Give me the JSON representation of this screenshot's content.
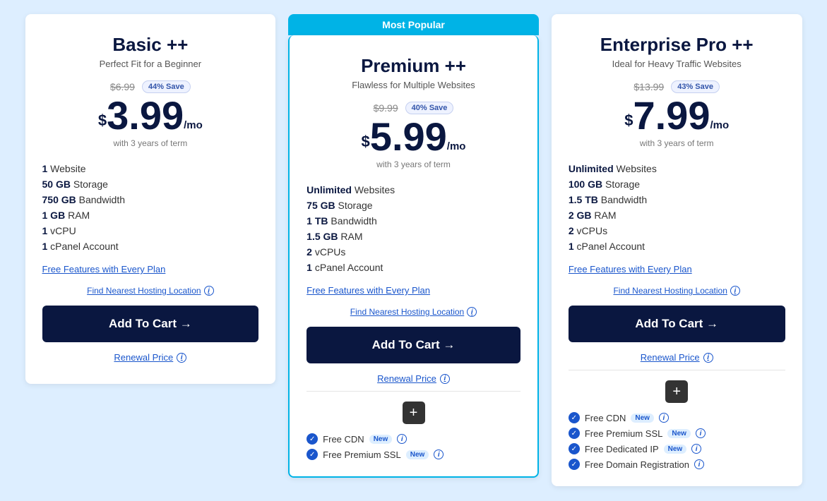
{
  "plans": [
    {
      "id": "basic",
      "title": "Basic ++",
      "subtitle": "Perfect Fit for a Beginner",
      "originalPrice": "$6.99",
      "saveBadge": "44% Save",
      "dollarSign": "$",
      "priceNumber": "3.99",
      "perMo": "/mo",
      "priceNote": "with 3 years of term",
      "features": [
        {
          "bold": "1",
          "text": " Website"
        },
        {
          "bold": "50 GB",
          "text": " Storage"
        },
        {
          "bold": "750 GB",
          "text": " Bandwidth"
        },
        {
          "bold": "1 GB",
          "text": " RAM"
        },
        {
          "bold": "1",
          "text": " vCPU"
        },
        {
          "bold": "1",
          "text": " cPanel Account"
        }
      ],
      "freeFeaturesLabel": "Free Features with Every Plan",
      "hostingLocationLabel": "Find Nearest Hosting Location",
      "addToCartLabel": "Add To Cart →",
      "renewalPriceLabel": "Renewal Price",
      "featured": false,
      "bonusFeatures": []
    },
    {
      "id": "premium",
      "title": "Premium ++",
      "subtitle": "Flawless for Multiple Websites",
      "originalPrice": "$9.99",
      "saveBadge": "40% Save",
      "dollarSign": "$",
      "priceNumber": "5.99",
      "perMo": "/mo",
      "priceNote": "with 3 years of term",
      "features": [
        {
          "bold": "Unlimited",
          "text": " Websites"
        },
        {
          "bold": "75 GB",
          "text": " Storage"
        },
        {
          "bold": "1 TB",
          "text": " Bandwidth"
        },
        {
          "bold": "1.5 GB",
          "text": " RAM"
        },
        {
          "bold": "2",
          "text": " vCPUs"
        },
        {
          "bold": "1",
          "text": " cPanel Account"
        }
      ],
      "freeFeaturesLabel": "Free Features with Every Plan",
      "hostingLocationLabel": "Find Nearest Hosting Location",
      "addToCartLabel": "Add To Cart →",
      "renewalPriceLabel": "Renewal Price",
      "featured": true,
      "mostPopularLabel": "Most Popular",
      "bonusFeatures": [
        {
          "text": "Free CDN",
          "badge": "New"
        },
        {
          "text": "Free Premium SSL",
          "badge": "New"
        }
      ]
    },
    {
      "id": "enterprise",
      "title": "Enterprise Pro ++",
      "subtitle": "Ideal for Heavy Traffic Websites",
      "originalPrice": "$13.99",
      "saveBadge": "43% Save",
      "dollarSign": "$",
      "priceNumber": "7.99",
      "perMo": "/mo",
      "priceNote": "with 3 years of term",
      "features": [
        {
          "bold": "Unlimited",
          "text": " Websites"
        },
        {
          "bold": "100 GB",
          "text": " Storage"
        },
        {
          "bold": "1.5 TB",
          "text": " Bandwidth"
        },
        {
          "bold": "2 GB",
          "text": " RAM"
        },
        {
          "bold": "2",
          "text": " vCPUs"
        },
        {
          "bold": "1",
          "text": " cPanel Account"
        }
      ],
      "freeFeaturesLabel": "Free Features with Every Plan",
      "hostingLocationLabel": "Find Nearest Hosting Location",
      "addToCartLabel": "Add To Cart →",
      "renewalPriceLabel": "Renewal Price",
      "featured": false,
      "bonusFeatures": [
        {
          "text": "Free CDN",
          "badge": "New"
        },
        {
          "text": "Free Premium SSL",
          "badge": "New"
        },
        {
          "text": "Free Dedicated IP",
          "badge": "New"
        },
        {
          "text": "Free Domain Registration",
          "badge": ""
        }
      ]
    }
  ]
}
